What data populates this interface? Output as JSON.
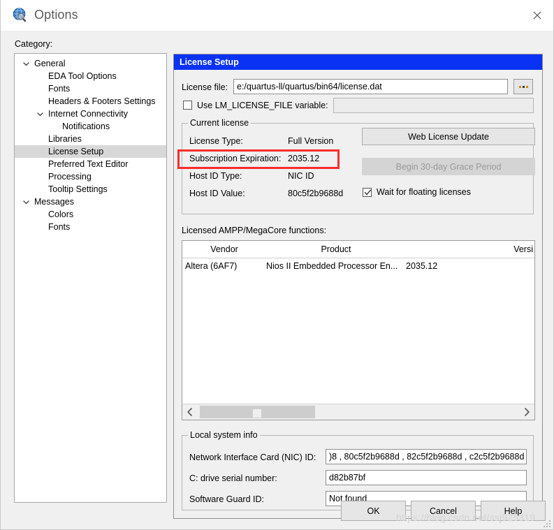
{
  "window": {
    "title": "Options",
    "icon": "quartus-globe-icon",
    "close_label": "✕"
  },
  "sidebar": {
    "label": "Category:",
    "items": [
      {
        "label": "General",
        "indent": 0,
        "arrow": "chevron-down",
        "selected": false
      },
      {
        "label": "EDA Tool Options",
        "indent": 1,
        "arrow": "",
        "selected": false
      },
      {
        "label": "Fonts",
        "indent": 1,
        "arrow": "",
        "selected": false
      },
      {
        "label": "Headers & Footers Settings",
        "indent": 1,
        "arrow": "",
        "selected": false
      },
      {
        "label": "Internet Connectivity",
        "indent": 1,
        "arrow": "chevron-down",
        "selected": false
      },
      {
        "label": "Notifications",
        "indent": 2,
        "arrow": "",
        "selected": false
      },
      {
        "label": "Libraries",
        "indent": 1,
        "arrow": "",
        "selected": false
      },
      {
        "label": "License Setup",
        "indent": 1,
        "arrow": "",
        "selected": true
      },
      {
        "label": "Preferred Text Editor",
        "indent": 1,
        "arrow": "",
        "selected": false
      },
      {
        "label": "Processing",
        "indent": 1,
        "arrow": "",
        "selected": false
      },
      {
        "label": "Tooltip Settings",
        "indent": 1,
        "arrow": "",
        "selected": false
      },
      {
        "label": "Messages",
        "indent": 0,
        "arrow": "chevron-down",
        "selected": false
      },
      {
        "label": "Colors",
        "indent": 1,
        "arrow": "",
        "selected": false
      },
      {
        "label": "Fonts",
        "indent": 1,
        "arrow": "",
        "selected": false
      }
    ]
  },
  "panel": {
    "header": "License Setup",
    "license_file": {
      "label": "License file:",
      "value": "e:/quartus-ll/quartus/bin64/license.dat",
      "browse_label": "..."
    },
    "lm_license": {
      "label": "Use LM_LICENSE_FILE variable:",
      "checked": false,
      "value": ""
    },
    "current_license": {
      "title": "Current license",
      "rows": [
        {
          "label": "License Type:",
          "value": "Full Version"
        },
        {
          "label": "Subscription Expiration:",
          "value": "2035.12"
        },
        {
          "label": "Host ID Type:",
          "value": "NIC ID"
        },
        {
          "label": "Host ID Value:",
          "value": "80c5f2b9688d"
        }
      ],
      "web_update_button": "Web License Update",
      "grace_button": "Begin 30-day Grace Period",
      "wait_floating": {
        "label": "Wait for floating licenses",
        "checked": true
      }
    },
    "licensed_functions": {
      "label": "Licensed AMPP/MegaCore functions:",
      "columns": [
        "Vendor",
        "Product",
        "Versi"
      ],
      "rows": [
        [
          "Altera (6AF7)",
          "Nios II Embedded Processor En...",
          "2035.12"
        ]
      ]
    },
    "local_system_info": {
      "title": "Local system info",
      "rows": [
        {
          "label": "Network Interface Card (NIC) ID:",
          "value": ")8 , 80c5f2b9688d , 82c5f2b9688d , c2c5f2b9688d"
        },
        {
          "label": "C: drive serial number:",
          "value": "d82b87bf"
        },
        {
          "label": "Software Guard ID:",
          "value": "Not found"
        }
      ]
    }
  },
  "footer": {
    "ok": "OK",
    "cancel": "Cancel",
    "help": "Help"
  },
  "watermark": "https://blog.csdn.net/ssj925319",
  "colors": {
    "panel_header_blue": "#0a32f4",
    "highlight_red": "#fb2c2c",
    "selection_grey": "#d8d8d8"
  }
}
